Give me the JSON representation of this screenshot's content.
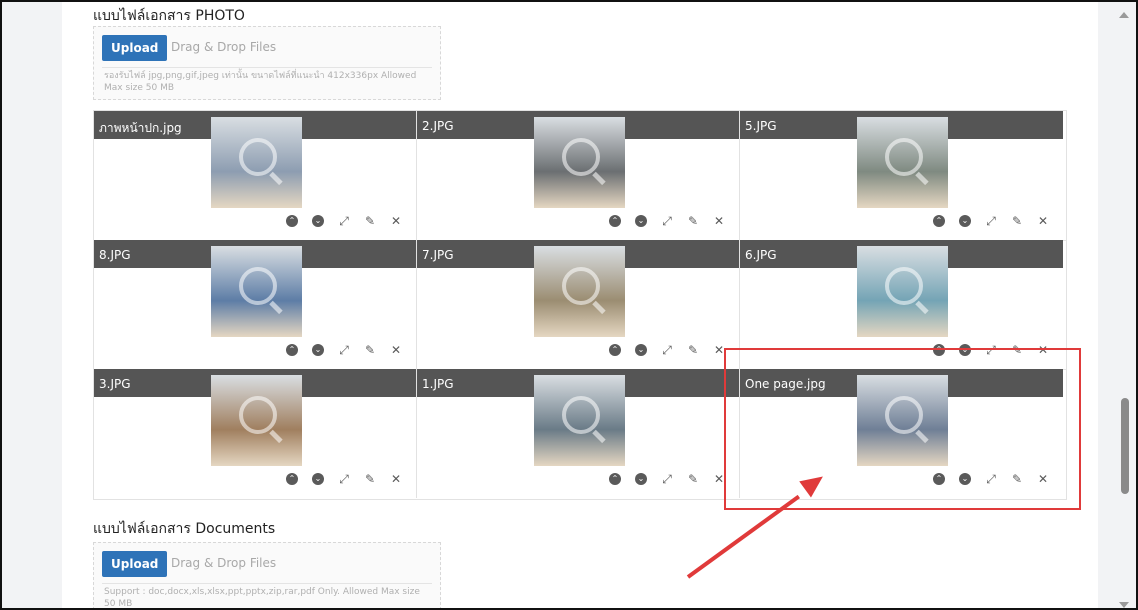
{
  "photo_section": {
    "title": "แบบไฟล์เอกสาร PHOTO",
    "upload_label": "Upload",
    "drag_drop_label": "Drag & Drop Files",
    "hint": "รองรับไฟล์ jpg,png,gif,jpeg เท่านั้น ขนาดไฟล์ที่แนะนำ 412x336px Allowed Max size 50 MB"
  },
  "gallery": {
    "cells": [
      {
        "name": "ภาพหน้าปก.jpg",
        "thumb_color": "#8d9db1"
      },
      {
        "name": "2.JPG",
        "thumb_color": "#6b6f72"
      },
      {
        "name": "5.JPG",
        "thumb_color": "#7f8a81"
      },
      {
        "name": "8.JPG",
        "thumb_color": "#5d7da6"
      },
      {
        "name": "7.JPG",
        "thumb_color": "#9b8d72"
      },
      {
        "name": "6.JPG",
        "thumb_color": "#74a4b5"
      },
      {
        "name": "3.JPG",
        "thumb_color": "#a07f5f"
      },
      {
        "name": "1.JPG",
        "thumb_color": "#6a7b87"
      },
      {
        "name": "One page.jpg",
        "thumb_color": "#6f7f96"
      }
    ],
    "actions": [
      {
        "icon": "move-up-icon",
        "glyph": "⌃"
      },
      {
        "icon": "move-down-icon",
        "glyph": "⌄"
      },
      {
        "icon": "expand-icon",
        "glyph": "⤢"
      },
      {
        "icon": "edit-icon",
        "glyph": "✎"
      },
      {
        "icon": "delete-icon",
        "glyph": "✕"
      }
    ]
  },
  "documents_section": {
    "title": "แบบไฟล์เอกสาร Documents",
    "upload_label": "Upload",
    "drag_drop_label": "Drag & Drop Files",
    "hint": "Support : doc,docx,xls,xlsx,ppt,pptx,zip,rar,pdf Only. Allowed Max size 50 MB"
  },
  "colors": {
    "accent": "#2e73b8",
    "header_bar": "#555555",
    "annotation": "#e03a3a"
  }
}
